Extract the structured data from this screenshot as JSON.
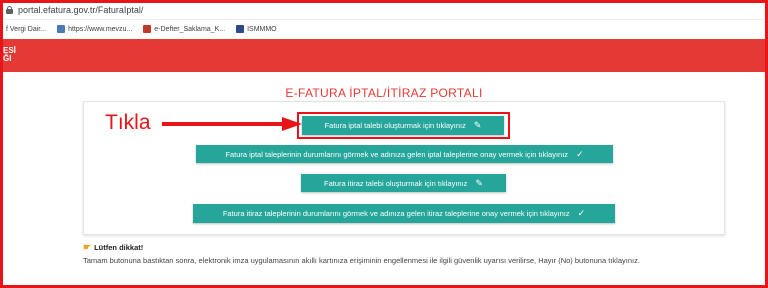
{
  "browser": {
    "url": "portal.efatura.gov.tr/FaturaIptal/",
    "bookmarks": [
      {
        "label": "f Vergi Dair...",
        "icon": "blank-icon",
        "color": "#ffffff"
      },
      {
        "label": "https://www.mevzu...",
        "icon": "mevzuat-icon",
        "color": "#4a7ab5"
      },
      {
        "label": "e-Defter_Saklama_K...",
        "icon": "edefter-icon",
        "color": "#c0392b"
      },
      {
        "label": "ISMMMO",
        "icon": "ismmmo-icon",
        "color": "#2c4a8a"
      }
    ]
  },
  "header": {
    "brand_line1": "ESİ",
    "brand_line2": "ĞI",
    "banner_color": "#e53935"
  },
  "main": {
    "title": "E-FATURA İPTAL/İTİRAZ PORTALI",
    "buttons": [
      {
        "label": "Fatura iptal talebi oluşturmak için tıklayınız",
        "icon": "pencil-icon"
      },
      {
        "label": "Fatura iptal taleplerinin durumlarını görmek ve adınıza gelen iptal taleplerine onay vermek için tıklayınız",
        "icon": "check-icon"
      },
      {
        "label": "Fatura itiraz talebi oluşturmak için tıklayınız",
        "icon": "pencil-icon"
      },
      {
        "label": "Fatura itiraz taleplerinin durumlarını görmek ve adınıza gelen itiraz taleplerine onay vermek için tıklayınız",
        "icon": "check-icon"
      }
    ],
    "button_color": "#26a69a"
  },
  "annotation": {
    "label": "Tıkla",
    "color": "#e8141a"
  },
  "notice": {
    "heading": "Lütfen dikkat!",
    "icon": "pointing-hand-icon",
    "text": "Tamam butonuna bastıktan sonra, elektronik imza uygulamasının akıllı kartınıza erişiminin engellenmesi ile ilgili güvenlik uyarısı verilirse, Hayır (No) butonuna tıklayınız."
  }
}
